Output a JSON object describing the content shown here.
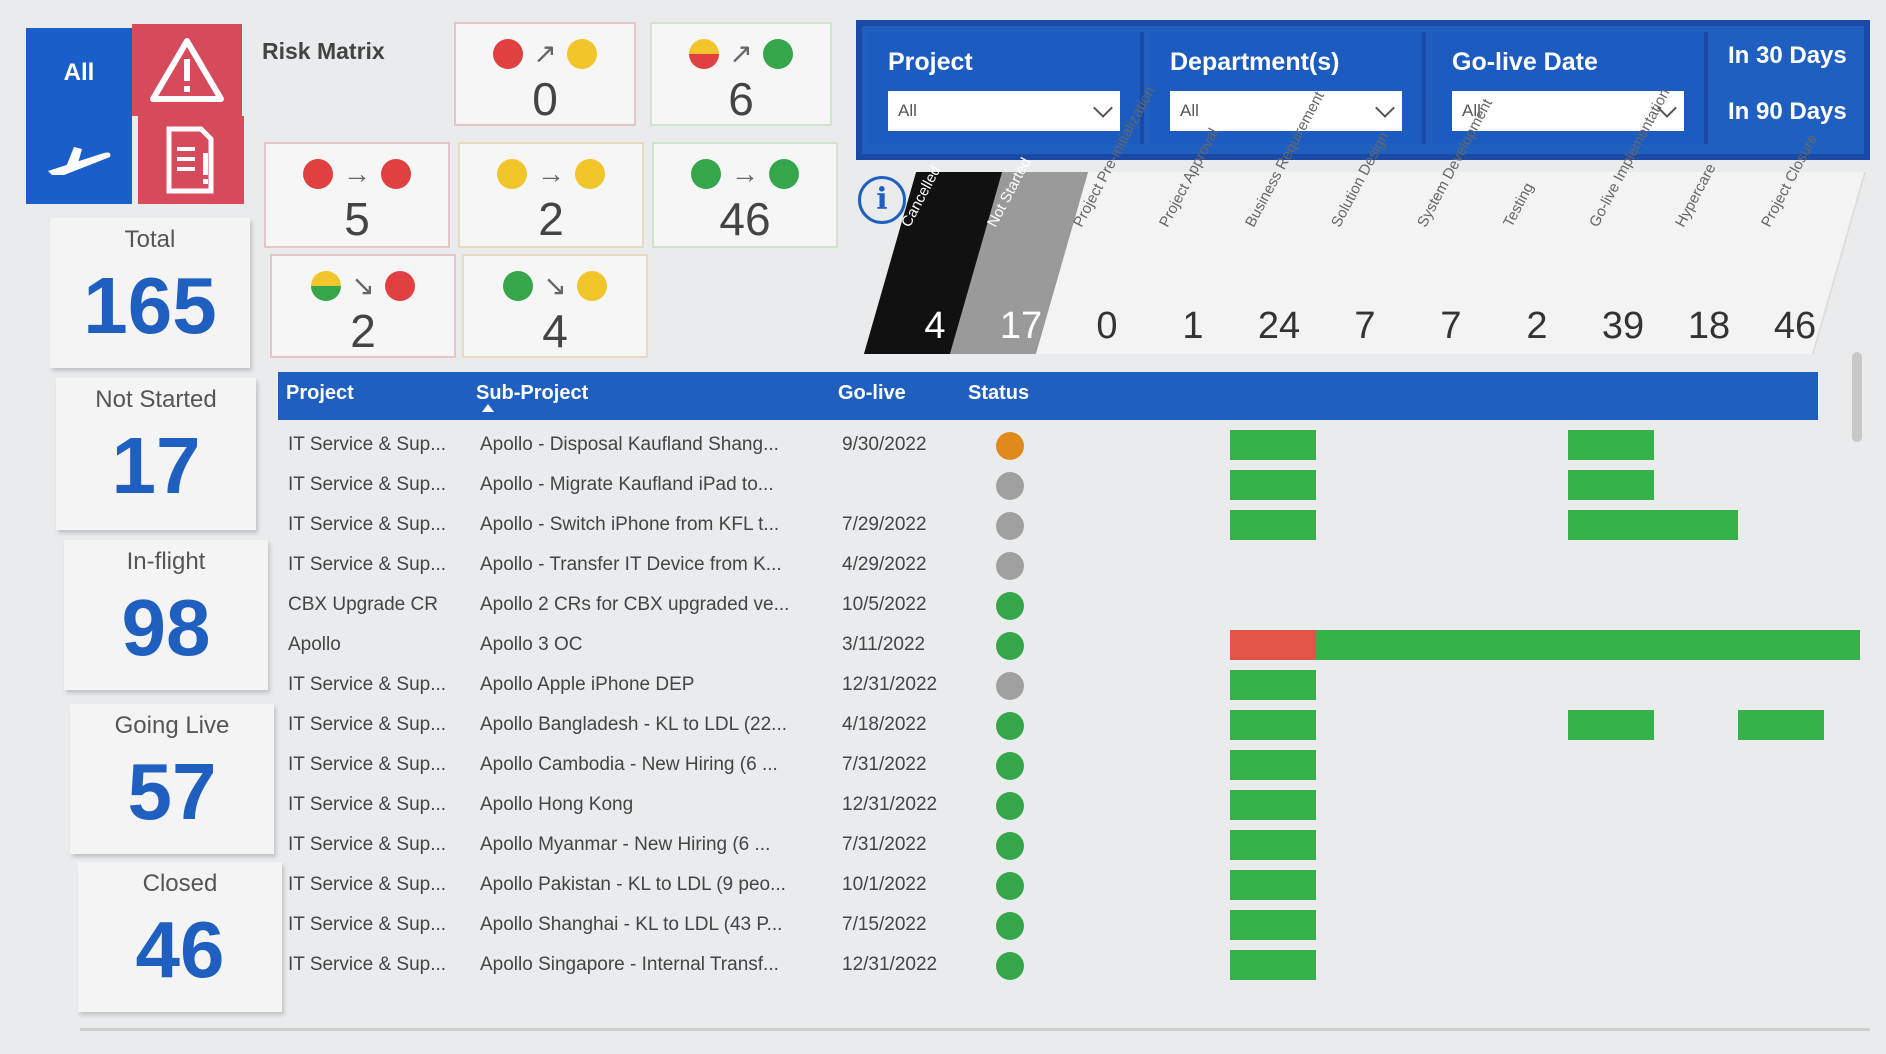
{
  "nav": {
    "all_label": "All"
  },
  "kpis": [
    {
      "label": "Total",
      "value": "165"
    },
    {
      "label": "Not Started",
      "value": "17"
    },
    {
      "label": "In-flight",
      "value": "98"
    },
    {
      "label": "Going Live",
      "value": "57"
    },
    {
      "label": "Closed",
      "value": "46"
    }
  ],
  "risk_matrix": {
    "title": "Risk Matrix",
    "cells": [
      {
        "from": "red",
        "to": "yellow",
        "arrow": "↗",
        "value": "0"
      },
      {
        "from": "ry",
        "to": "green",
        "arrow": "↗",
        "value": "6"
      },
      {
        "from": "red",
        "to": "red",
        "arrow": "→",
        "value": "5"
      },
      {
        "from": "yellow",
        "to": "yellow",
        "arrow": "→",
        "value": "2"
      },
      {
        "from": "green",
        "to": "green",
        "arrow": "→",
        "value": "46"
      },
      {
        "from": "gy",
        "to": "red",
        "arrow": "↘",
        "value": "2"
      },
      {
        "from": "green",
        "to": "yellow",
        "arrow": "↘",
        "value": "4"
      }
    ]
  },
  "filters": {
    "project": {
      "label": "Project",
      "value": "All"
    },
    "department": {
      "label": "Department(s)",
      "value": "All"
    },
    "golive": {
      "label": "Go-live Date",
      "value": "All"
    },
    "in30": "In 30 Days",
    "in90": "In 90 Days"
  },
  "stages": [
    {
      "label": "Cancelled",
      "count": "4"
    },
    {
      "label": "Not Started",
      "count": "17"
    },
    {
      "label": "Project Pre-initialization",
      "count": "0"
    },
    {
      "label": "Project Approval",
      "count": "1"
    },
    {
      "label": "Business Requirement",
      "count": "24"
    },
    {
      "label": "Solution Design",
      "count": "7"
    },
    {
      "label": "System Development",
      "count": "7"
    },
    {
      "label": "Testing",
      "count": "2"
    },
    {
      "label": "Go-live Implementation",
      "count": "39"
    },
    {
      "label": "Hypercare",
      "count": "18"
    },
    {
      "label": "Project Closure",
      "count": "46"
    }
  ],
  "table": {
    "headers": {
      "project": "Project",
      "subproject": "Sub-Project",
      "golive": "Go-live",
      "status": "Status"
    },
    "status_colors": {
      "orange": "#e08a1e",
      "grey": "#a0a0a0",
      "green": "#36a64a"
    },
    "rows": [
      {
        "project": "IT Service & Sup...",
        "subproject": "Apollo - Disposal Kaufland Shang...",
        "golive": "9/30/2022",
        "status": "orange"
      },
      {
        "project": "IT Service & Sup...",
        "subproject": "Apollo - Migrate Kaufland iPad to...",
        "golive": "",
        "status": "grey"
      },
      {
        "project": "IT Service & Sup...",
        "subproject": "Apollo - Switch iPhone from KFL t...",
        "golive": "7/29/2022",
        "status": "grey"
      },
      {
        "project": "IT Service & Sup...",
        "subproject": "Apollo - Transfer IT Device from K...",
        "golive": "4/29/2022",
        "status": "grey"
      },
      {
        "project": "CBX Upgrade CR",
        "subproject": "Apollo 2 CRs for CBX upgraded ve...",
        "golive": "10/5/2022",
        "status": "green"
      },
      {
        "project": "Apollo",
        "subproject": "Apollo 3 OC",
        "golive": "3/11/2022",
        "status": "green"
      },
      {
        "project": "IT Service & Sup...",
        "subproject": "Apollo Apple iPhone DEP",
        "golive": "12/31/2022",
        "status": "grey"
      },
      {
        "project": "IT Service & Sup...",
        "subproject": "Apollo Bangladesh - KL to LDL (22...",
        "golive": "4/18/2022",
        "status": "green"
      },
      {
        "project": "IT Service & Sup...",
        "subproject": "Apollo Cambodia - New Hiring (6 ...",
        "golive": "7/31/2022",
        "status": "green"
      },
      {
        "project": "IT Service & Sup...",
        "subproject": "Apollo Hong Kong",
        "golive": "12/31/2022",
        "status": "green"
      },
      {
        "project": "IT Service & Sup...",
        "subproject": "Apollo Myanmar - New Hiring (6 ...",
        "golive": "7/31/2022",
        "status": "green"
      },
      {
        "project": "IT Service & Sup...",
        "subproject": "Apollo Pakistan - KL to LDL (9 peo...",
        "golive": "10/1/2022",
        "status": "green"
      },
      {
        "project": "IT Service & Sup...",
        "subproject": "Apollo Shanghai - KL to LDL (43 P...",
        "golive": "7/15/2022",
        "status": "green"
      },
      {
        "project": "IT Service & Sup...",
        "subproject": "Apollo Singapore - Internal Transf...",
        "golive": "12/31/2022",
        "status": "green"
      }
    ]
  }
}
